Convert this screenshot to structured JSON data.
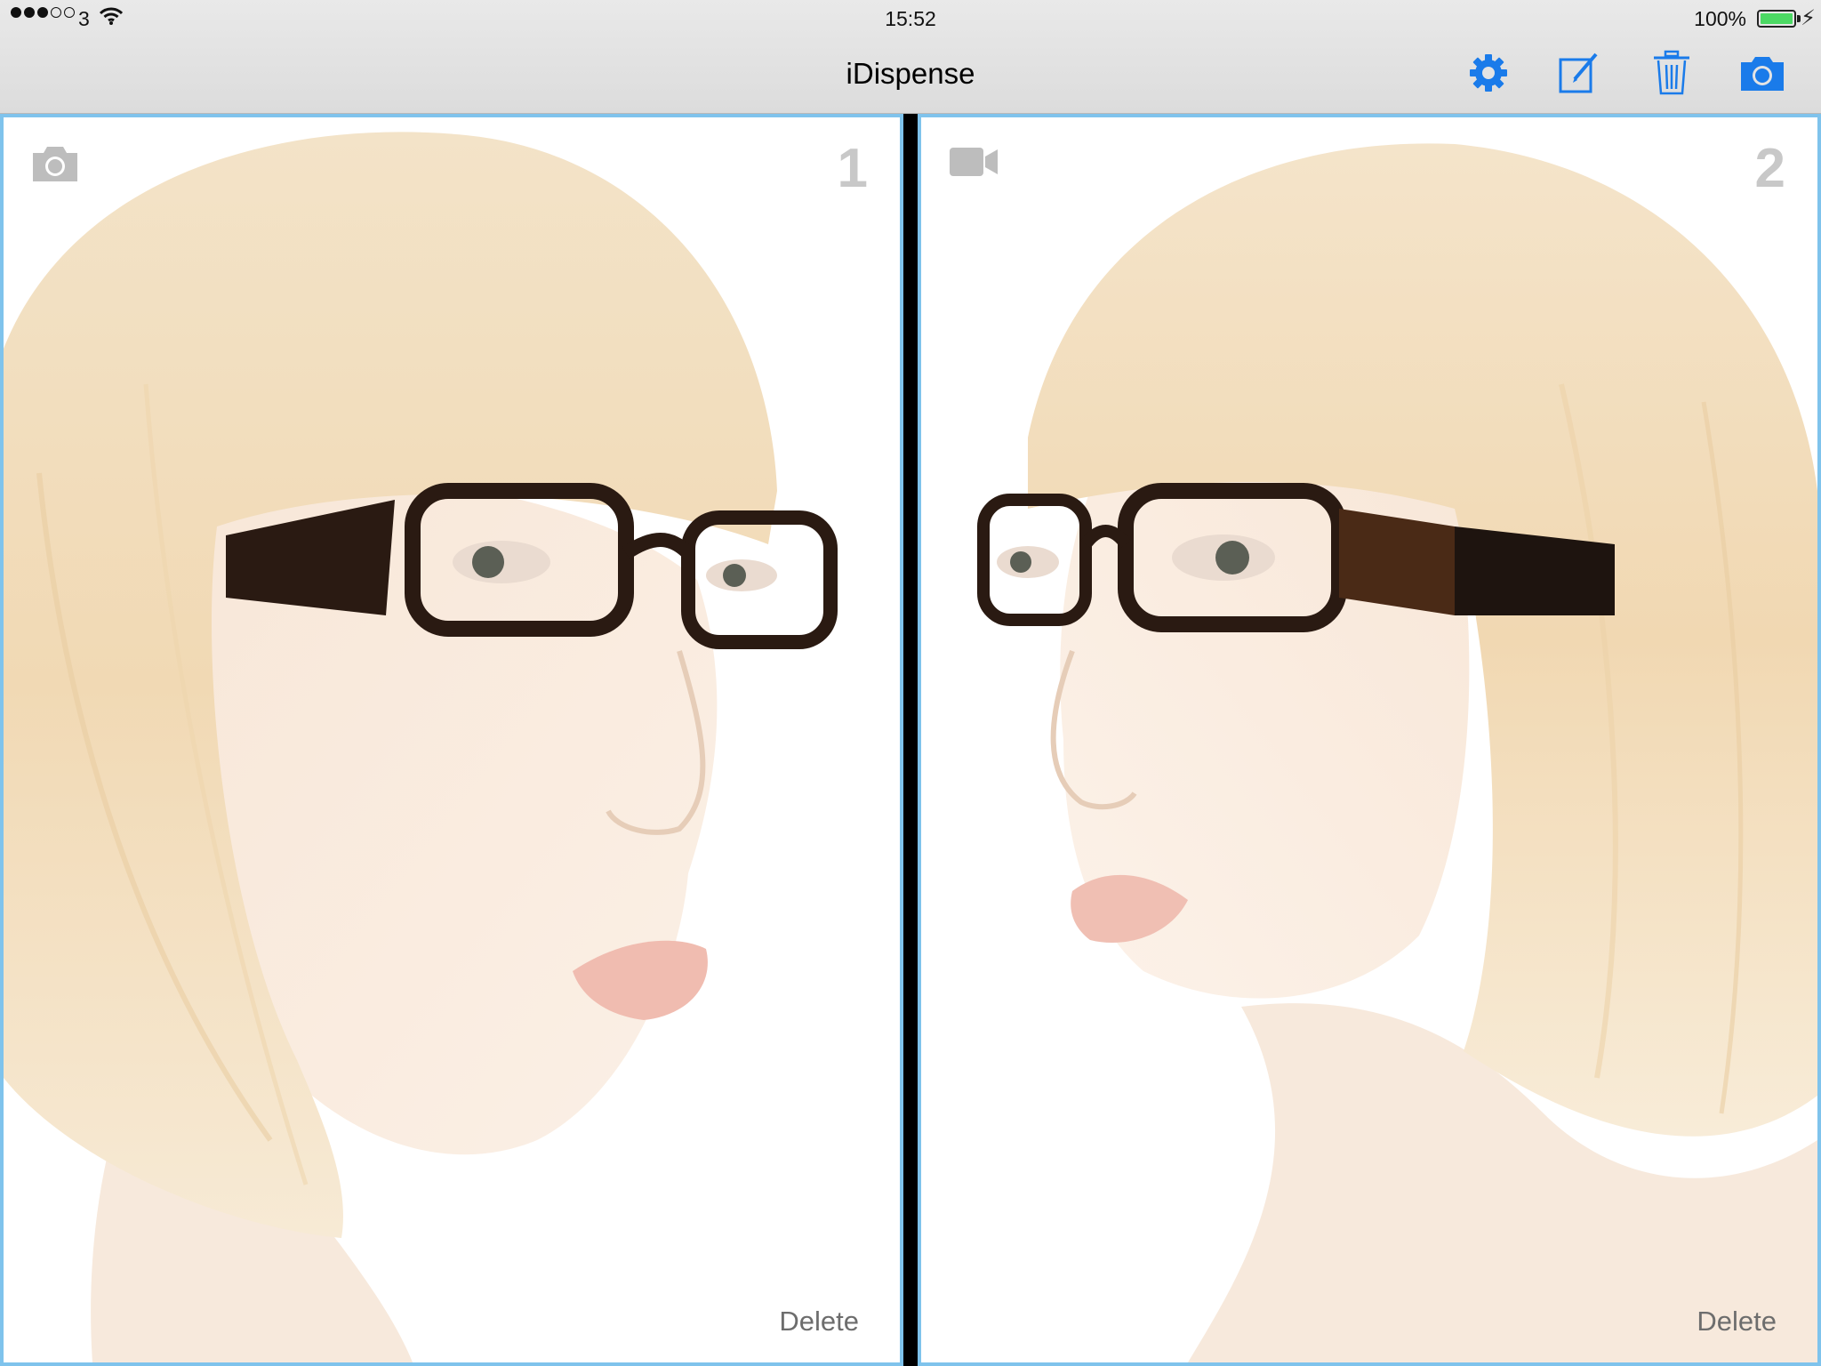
{
  "status_bar": {
    "carrier": "3",
    "time": "15:52",
    "battery": "100%"
  },
  "nav": {
    "title": "iDispense",
    "buttons": [
      {
        "icon": "gear-icon",
        "label": "Settings"
      },
      {
        "icon": "compose-icon",
        "label": "Edit"
      },
      {
        "icon": "trash-icon",
        "label": "Trash"
      },
      {
        "icon": "camera-icon",
        "label": "Camera"
      }
    ]
  },
  "panels": [
    {
      "number": "1",
      "media_icon": "camera-icon",
      "delete_label": "Delete"
    },
    {
      "number": "2",
      "media_icon": "video-camera-icon",
      "delete_label": "Delete"
    }
  ],
  "colors": {
    "accent": "#1a7bea",
    "panel_border": "#7fc3ec",
    "inactive": "#c8c8c8"
  }
}
